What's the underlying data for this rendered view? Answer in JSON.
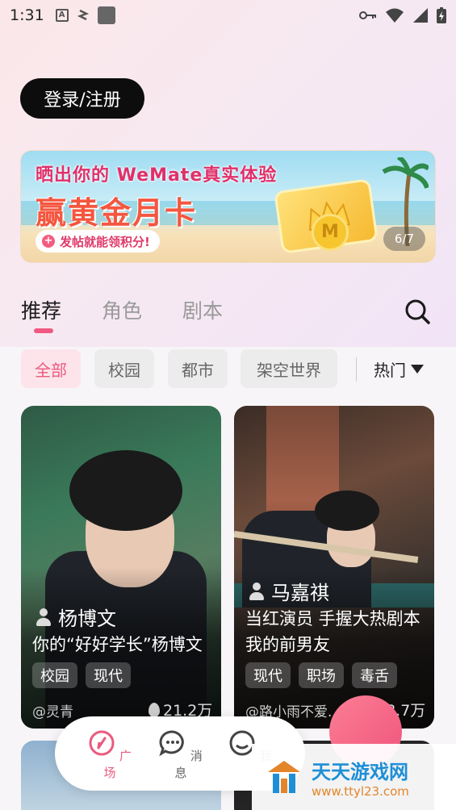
{
  "status_bar": {
    "time": "1:31",
    "a_icon": "A"
  },
  "login": {
    "label": "登录/注册"
  },
  "banner": {
    "line1": "晒出你的 WeMate真实体验",
    "line2": "赢黄金月卡",
    "line3": "发帖就能领积分!",
    "line3_prefix": "+",
    "coin_letter": "M",
    "page_indicator": "6/7"
  },
  "tabs": [
    "推荐",
    "角色",
    "剧本"
  ],
  "filters": {
    "chips": [
      "全部",
      "校园",
      "都市",
      "架空世界"
    ],
    "sort_label": "热门"
  },
  "cards": [
    {
      "name": "杨博文",
      "desc": "你的“好好学长”杨博文",
      "tags": [
        "校园",
        "现代"
      ],
      "author": "@灵青",
      "heat": "21.2万"
    },
    {
      "name": "马嘉祺",
      "desc": "当红演员 手握大热剧本 我的前男友",
      "tags": [
        "现代",
        "职场",
        "毒舌"
      ],
      "author": "@路小雨不爱...",
      "heat": "18.7万"
    }
  ],
  "bottom_nav": {
    "items": [
      "广场",
      "消息",
      "我"
    ]
  },
  "watermark": {
    "title": "天天游戏网",
    "url": "www.ttyl23.com"
  },
  "colors": {
    "accent": "#ea5a7e",
    "dark_button": "#0d0d0d"
  }
}
